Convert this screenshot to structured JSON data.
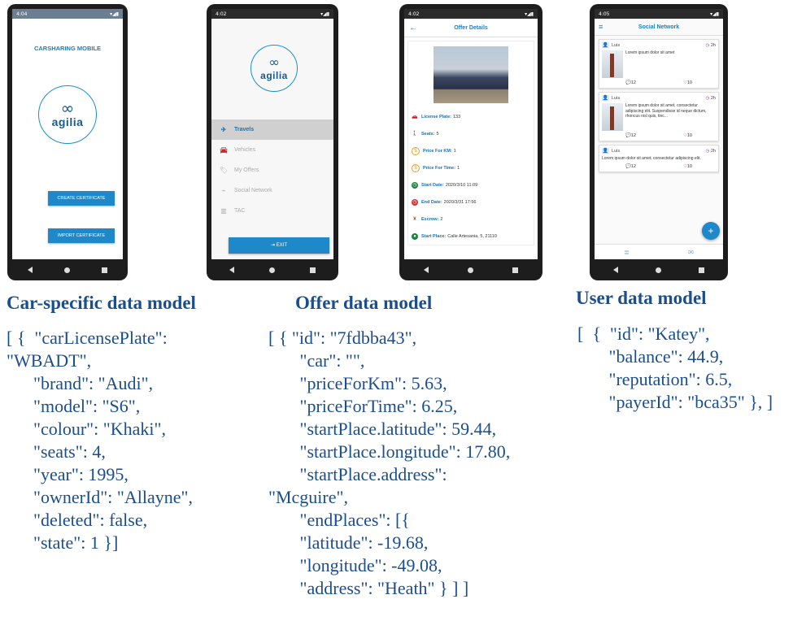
{
  "phone1": {
    "time": "4:04",
    "title": "CARSHARING MOBILE",
    "logo_text": "agilia",
    "create_button": "CREATE CERTIFICATE",
    "import_button": "IMPORT CERTIFICATE"
  },
  "phone2": {
    "time": "4:02",
    "logo_text": "agilia",
    "menu": [
      {
        "label": "Travels"
      },
      {
        "label": "Vehicles"
      },
      {
        "label": "My Offers"
      },
      {
        "label": "Social Network"
      },
      {
        "label": "TAC"
      }
    ],
    "exit_button": "EXIT"
  },
  "phone3": {
    "time": "4:02",
    "title": "Offer Details",
    "rows": [
      {
        "label": "License Plate:",
        "value": "133",
        "color": "#e89020"
      },
      {
        "label": "Seats:",
        "value": "5",
        "color": "#e040a0"
      },
      {
        "label": "Price For KM:",
        "value": "1",
        "color": "#e8a020"
      },
      {
        "label": "Price For Time:",
        "value": "1",
        "color": "#e8a020"
      },
      {
        "label": "Start Date:",
        "value": "2020/3/10 11:09",
        "color": "#208040"
      },
      {
        "label": "End Date:",
        "value": "2020/3/31 17:56",
        "color": "#d03030"
      },
      {
        "label": "Escrow:",
        "value": "2",
        "color": "#a07050"
      },
      {
        "label": "Start Place:",
        "value": "Calle Artesania, 5, 21110",
        "color": "#208040"
      }
    ]
  },
  "phone4": {
    "time": "4:05",
    "title": "Social Network",
    "posts": [
      {
        "user": "Luis",
        "time": "2h",
        "text": "Lorem ipsum dolor sit amet",
        "comments": "12",
        "likes": "10"
      },
      {
        "user": "Luis",
        "time": "2h",
        "text": "Lorem ipsum dolor sit amet, consectetur adipiscing elit. Suspendisse id neque dictum, rhoncus nisl quis, tinc...",
        "comments": "12",
        "likes": "10"
      },
      {
        "user": "Luis",
        "time": "2h",
        "text": "Lorem ipsum dolor sit amet, consectetur adipiscing elit.",
        "comments": "12",
        "likes": "10"
      }
    ]
  },
  "captions": {
    "car": "Car-specific data model",
    "offer": "Offer data model",
    "user": "User data model"
  },
  "code": {
    "car": "[ {  \"carLicensePlate\":\n\"WBADT\",\n      \"brand\": \"Audi\",\n      \"model\": \"S6\",\n      \"colour\": \"Khaki\",\n      \"seats\": 4,\n      \"year\": 1995,\n      \"ownerId\": \"Allayne\",\n      \"deleted\": false,\n      \"state\": 1 }]",
    "offer": "[ { \"id\": \"7fdbba43\",\n       \"car\": \"\",\n       \"priceForKm\": 5.63,\n       \"priceForTime\": 6.25,\n       \"startPlace.latitude\": 59.44,\n       \"startPlace.longitude\": 17.80,\n       \"startPlace.address\":\n\"Mcguire\",\n       \"endPlaces\": [{\n       \"latitude\": -19.68,\n       \"longitude\": -49.08,\n       \"address\": \"Heath\" } ] ]",
    "user": "[  {  \"id\": \"Katey\",\n       \"balance\": 44.9,\n       \"reputation\": 6.5,\n       \"payerId\": \"bca35\" }, ]"
  }
}
